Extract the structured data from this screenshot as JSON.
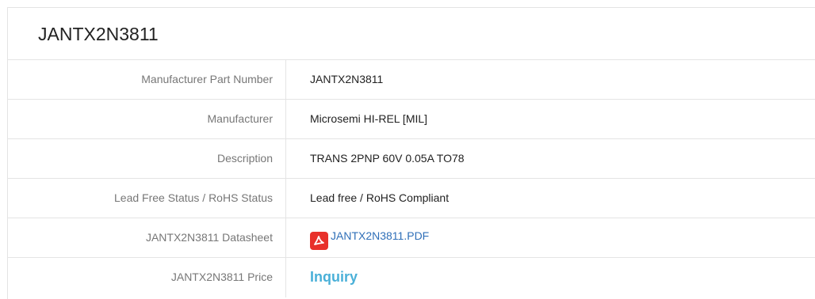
{
  "title": "JANTX2N3811",
  "rows": [
    {
      "label": "Manufacturer Part Number",
      "value": "JANTX2N3811"
    },
    {
      "label": "Manufacturer",
      "value": "Microsemi HI-REL [MIL]"
    },
    {
      "label": "Description",
      "value": "TRANS 2PNP 60V 0.05A TO78"
    },
    {
      "label": "Lead Free Status / RoHS Status",
      "value": "Lead free / RoHS Compliant"
    },
    {
      "label": "JANTX2N3811 Datasheet",
      "value": "JANTX2N3811.PDF",
      "icon": "pdf-icon"
    },
    {
      "label": "JANTX2N3811 Price",
      "value": "Inquiry"
    }
  ],
  "colors": {
    "pdf_icon": "#e8302a",
    "link": "#2f6fb8",
    "inquiry": "#4ab0d8"
  }
}
